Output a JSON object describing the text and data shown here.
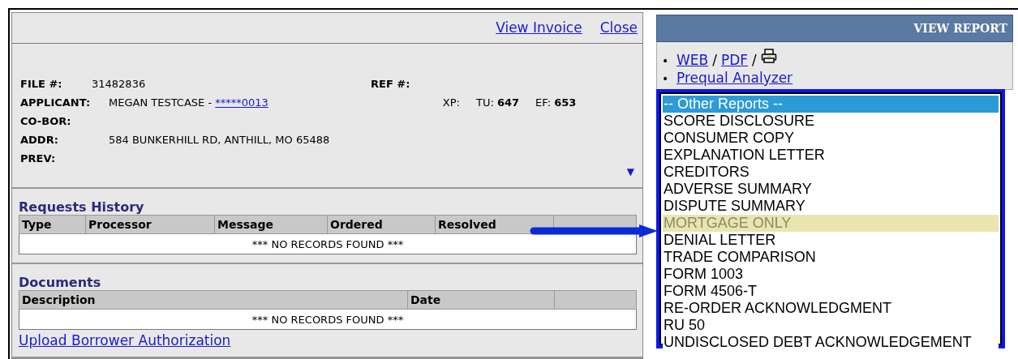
{
  "header_links": [
    "View Invoice",
    "Close"
  ],
  "file": {
    "label": "FILE #:",
    "value": "31482836",
    "ref_label": "REF #:"
  },
  "applicant": {
    "label": "APPLICANT:",
    "value": "MEGAN TESTCASE - ",
    "link": "*****0013",
    "scores": [
      {
        "label": "XP:"
      },
      {
        "label": "TU:",
        "value": "647"
      },
      {
        "label": "EF:",
        "value": "653"
      }
    ]
  },
  "fields": [
    {
      "label": "CO-BOR:"
    },
    {
      "label": "ADDR:",
      "value": "584 BUNKERHILL RD, ANTHILL, MO 65488"
    },
    {
      "label": "PREV:"
    }
  ],
  "expand_toggle": "▼",
  "requests_history": {
    "title": "Requests History",
    "columns": [
      "Type",
      "Processor",
      "Message",
      "Ordered",
      "Resolved",
      ""
    ],
    "empty_text": "*** NO RECORDS FOUND ***"
  },
  "documents": {
    "title": "Documents",
    "columns": [
      "Description",
      "Date",
      ""
    ],
    "empty_text": "*** NO RECORDS FOUND ***",
    "upload_link": "Upload Borrower Authorization"
  },
  "view_report": {
    "title": "VIEW REPORT",
    "bullets": [
      "•",
      "•"
    ],
    "links": [
      "WEB",
      "PDF"
    ],
    "separator": "/",
    "prequal_link": "Prequal Analyzer"
  },
  "other_reports": [
    {
      "label": "-- Other Reports --",
      "selected": true,
      "hovered": false
    },
    {
      "label": "SCORE DISCLOSURE",
      "selected": false,
      "hovered": false
    },
    {
      "label": "CONSUMER COPY",
      "selected": false,
      "hovered": false
    },
    {
      "label": "EXPLANATION LETTER",
      "selected": false,
      "hovered": false
    },
    {
      "label": "CREDITORS",
      "selected": false,
      "hovered": false
    },
    {
      "label": "ADVERSE SUMMARY",
      "selected": false,
      "hovered": false
    },
    {
      "label": "DISPUTE SUMMARY",
      "selected": false,
      "hovered": false
    },
    {
      "label": "MORTGAGE ONLY",
      "selected": false,
      "hovered": true
    },
    {
      "label": "DENIAL LETTER",
      "selected": false,
      "hovered": false
    },
    {
      "label": "TRADE COMPARISON",
      "selected": false,
      "hovered": false
    },
    {
      "label": "FORM 1003",
      "selected": false,
      "hovered": false
    },
    {
      "label": "FORM 4506-T",
      "selected": false,
      "hovered": false
    },
    {
      "label": "RE-ORDER ACKNOWLEDGMENT",
      "selected": false,
      "hovered": false
    },
    {
      "label": "RU 50",
      "selected": false,
      "hovered": false
    },
    {
      "label": "UNDISCLOSED DEBT ACKNOWLEDGEMENT",
      "selected": false,
      "hovered": false
    }
  ]
}
